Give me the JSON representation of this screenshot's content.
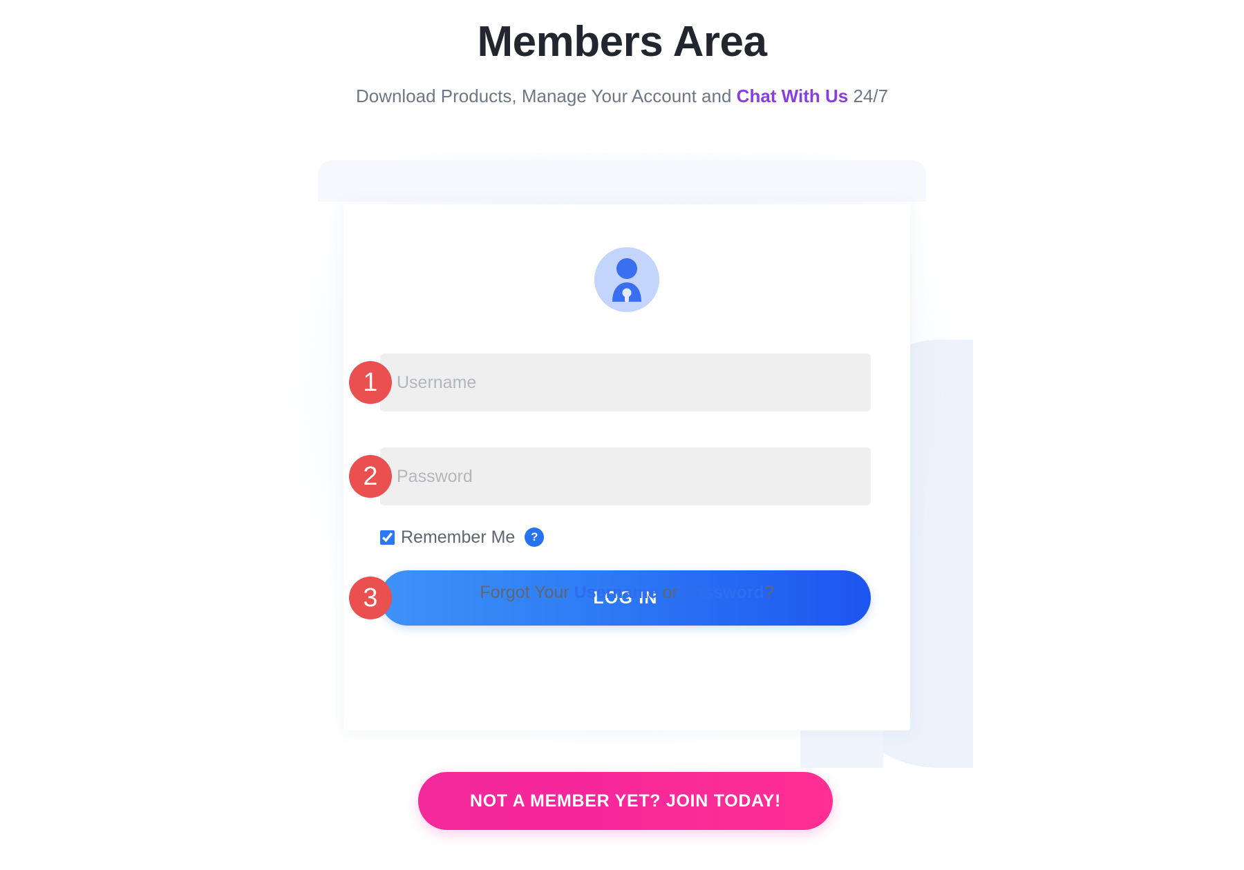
{
  "header": {
    "title": "Members Area",
    "subtitle_before": "Download Products, Manage Your Account and ",
    "subtitle_link": "Chat With Us",
    "subtitle_after": " 24/7"
  },
  "card": {
    "avatar_icon": "user-lock-avatar-icon",
    "steps": [
      {
        "number": "1"
      },
      {
        "number": "2"
      },
      {
        "number": "3"
      }
    ],
    "username_field": {
      "placeholder": "Username",
      "value": ""
    },
    "password_field": {
      "placeholder": "Password",
      "value": ""
    },
    "remember": {
      "label": "Remember Me",
      "checked": true,
      "help_icon_label": "?"
    },
    "login_button": {
      "label": "LOG IN"
    },
    "forgot": {
      "prefix": "Forgot Your ",
      "username_link": "Username",
      "separator": " or ",
      "password_link": "Password",
      "suffix": "?"
    }
  },
  "cta": {
    "join_label": "NOT A MEMBER YET? JOIN TODAY!"
  },
  "colors": {
    "title": "#22262e",
    "subtitle_text": "#6e7786",
    "chat_link": "#8b3ee0",
    "step_badge": "#e9504f",
    "login_gradient_start": "#3e92f7",
    "login_gradient_end": "#1d55f0",
    "join_gradient_start": "#f42a9a",
    "join_gradient_end": "#ff2f93",
    "forgot_link": "#2f6cf0",
    "avatar_circle": "#c3d4fd",
    "avatar_figure": "#3a6ff0",
    "input_background": "#efeff0",
    "placeholder": "#b3b6bb",
    "help_badge": "#2672ef",
    "deco_shape": "#e9f0fb"
  }
}
